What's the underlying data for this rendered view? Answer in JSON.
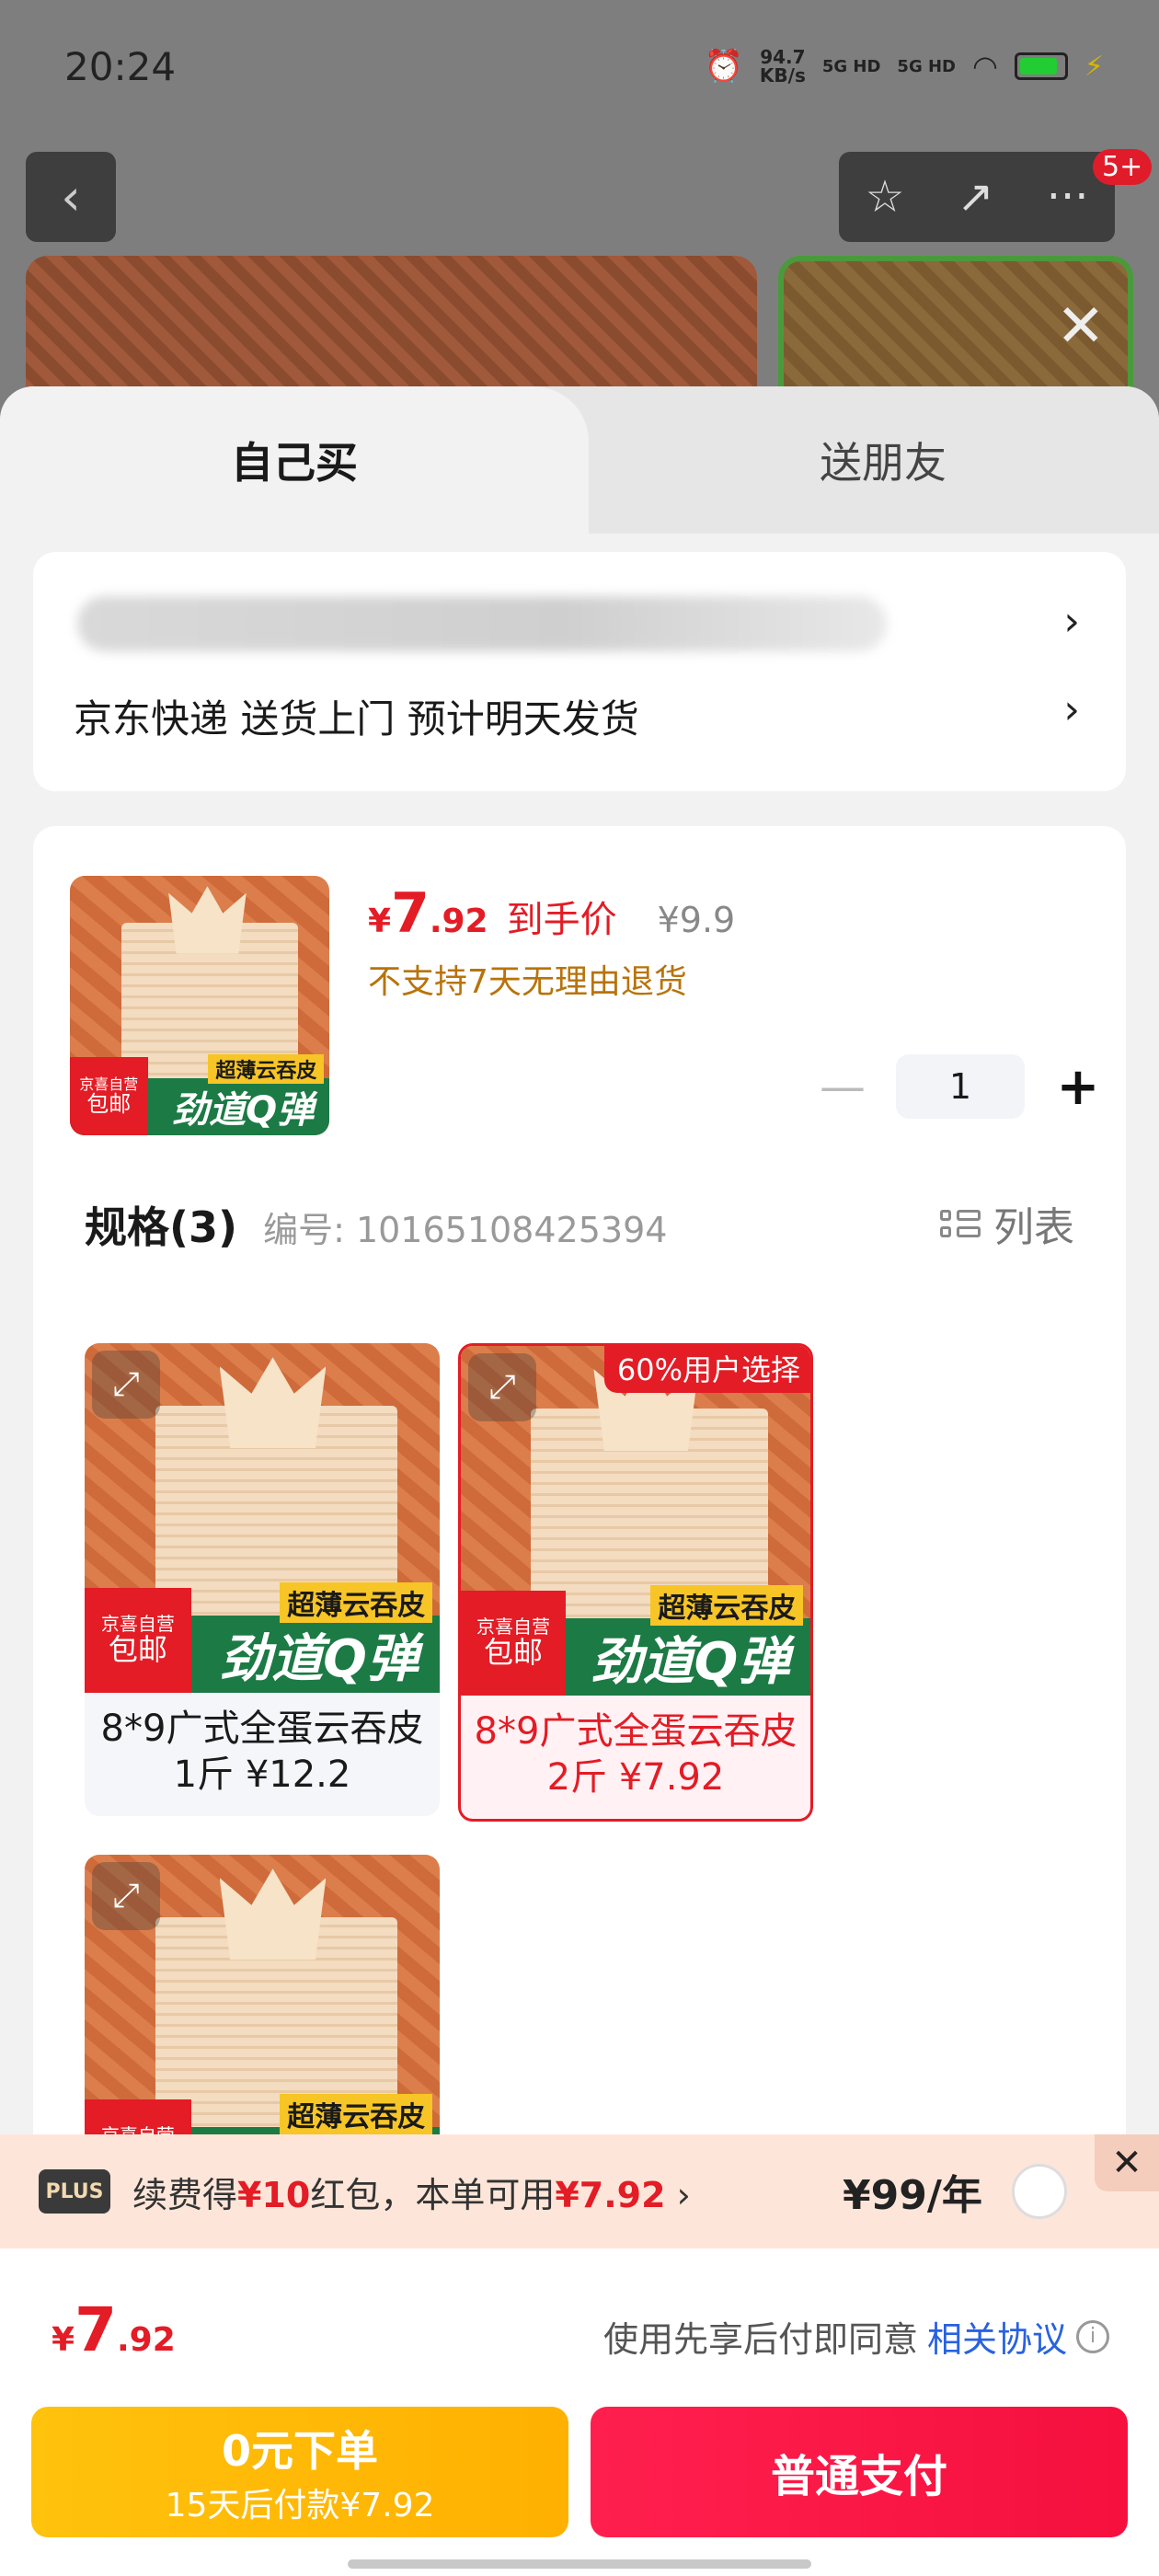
{
  "status_bar": {
    "time": "20:24",
    "net_speed": "94.7",
    "net_unit": "KB/s",
    "sig1": "5G HD",
    "sig2": "5G HD"
  },
  "background": {
    "badge": "5+"
  },
  "tabs": {
    "self": "自己买",
    "friend": "送朋友"
  },
  "address": {
    "shipping": "京东快递 送货上门 预计明天发货"
  },
  "product": {
    "price_currency": "¥",
    "price_int": "7",
    "price_dec": ".92",
    "price_label": "到手价",
    "original_price": "¥9.9",
    "return_policy": "不支持7天无理由退货",
    "quantity": "1"
  },
  "specs": {
    "title": "规格(3)",
    "code": "编号: 10165108425394",
    "list_label": "列表",
    "options": [
      {
        "label": "8*9广式全蛋云吞皮1斤  ¥12.2",
        "selected": false
      },
      {
        "label": "8*9广式全蛋云吞皮2斤  ¥7.92",
        "selected": true,
        "badge": "60%用户选择"
      },
      {
        "label": "",
        "selected": false
      }
    ],
    "art": {
      "yellow_tag": "超薄云吞皮",
      "strip": "劲道Q弹",
      "red_tag_top": "京喜自营",
      "red_tag_bottom": "包邮"
    }
  },
  "plus_bar": {
    "logo": "PLUS",
    "text_a": "续费得",
    "text_b": "¥10",
    "text_c": "红包，本单可用",
    "text_d": "¥7.92",
    "text_e": " ›",
    "price": "¥99/年"
  },
  "bottom": {
    "currency": "¥",
    "total_int": "7",
    "total_dec": ".92",
    "agree_text": "使用先享后付即同意",
    "agree_link": "相关协议",
    "later_line1": "0元下单",
    "later_line2": "15天后付款¥7.92",
    "pay_label": "普通支付"
  }
}
